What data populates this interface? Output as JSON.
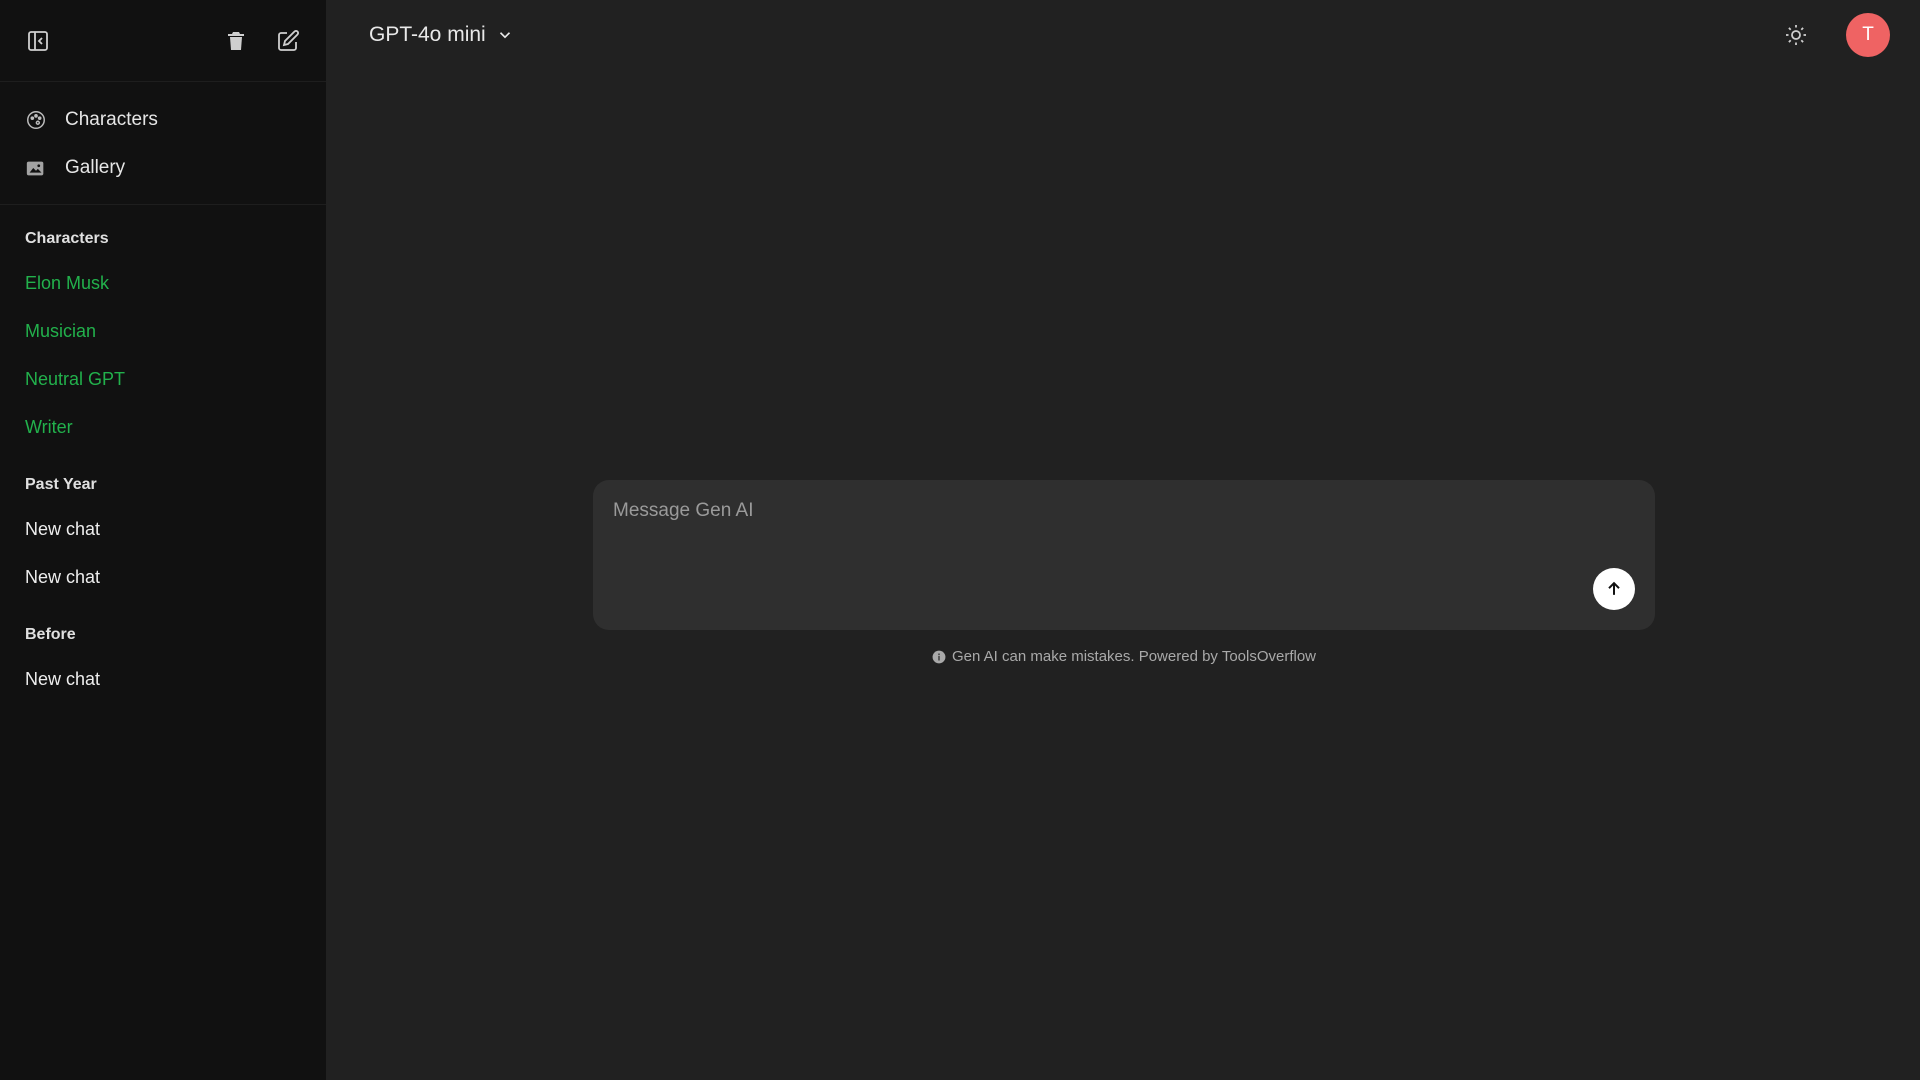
{
  "sidebar": {
    "nav": [
      {
        "label": "Characters",
        "icon": "palette-icon"
      },
      {
        "label": "Gallery",
        "icon": "image-icon"
      }
    ],
    "sections": [
      {
        "title": "Characters",
        "items": [
          "Elon Musk",
          "Musician",
          "Neutral GPT",
          "Writer"
        ]
      },
      {
        "title": "Past Year",
        "items": [
          "New chat",
          "New chat"
        ]
      },
      {
        "title": "Before",
        "items": [
          "New chat"
        ]
      }
    ]
  },
  "header": {
    "model_label": "GPT-4o mini",
    "avatar_initial": "T"
  },
  "composer": {
    "placeholder": "Message Gen AI"
  },
  "footer": {
    "disclaimer": "Gen AI can make mistakes. Powered by ToolsOverflow"
  },
  "colors": {
    "accent_green": "#22b14c",
    "avatar_bg": "#ef6363",
    "sidebar_bg": "#111111",
    "main_bg": "#212121",
    "composer_bg": "#2f2f2f"
  }
}
